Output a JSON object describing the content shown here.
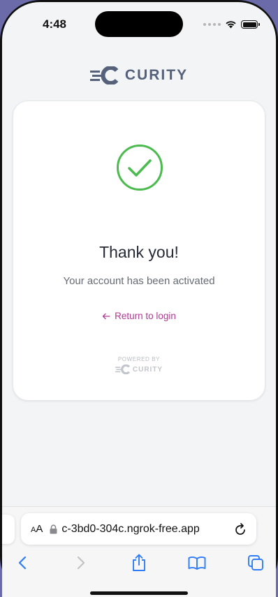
{
  "status_bar": {
    "time": "4:48"
  },
  "brand": {
    "name": "CURITY",
    "color": "#55607a"
  },
  "card": {
    "title": "Thank you!",
    "message": "Your account has been activated",
    "return_link": "Return to login",
    "powered_by_label": "POWERED BY",
    "powered_by_brand": "CURITY",
    "success_color": "#4cbb4f",
    "link_color": "#b03a94"
  },
  "browser": {
    "text_size_label_small": "A",
    "text_size_label_large": "A",
    "url": "c-3bd0-304c.ngrok-free.app",
    "icons": [
      "lock-icon",
      "reload-icon",
      "back-icon",
      "forward-icon",
      "share-icon",
      "bookmarks-icon",
      "tabs-icon"
    ]
  }
}
